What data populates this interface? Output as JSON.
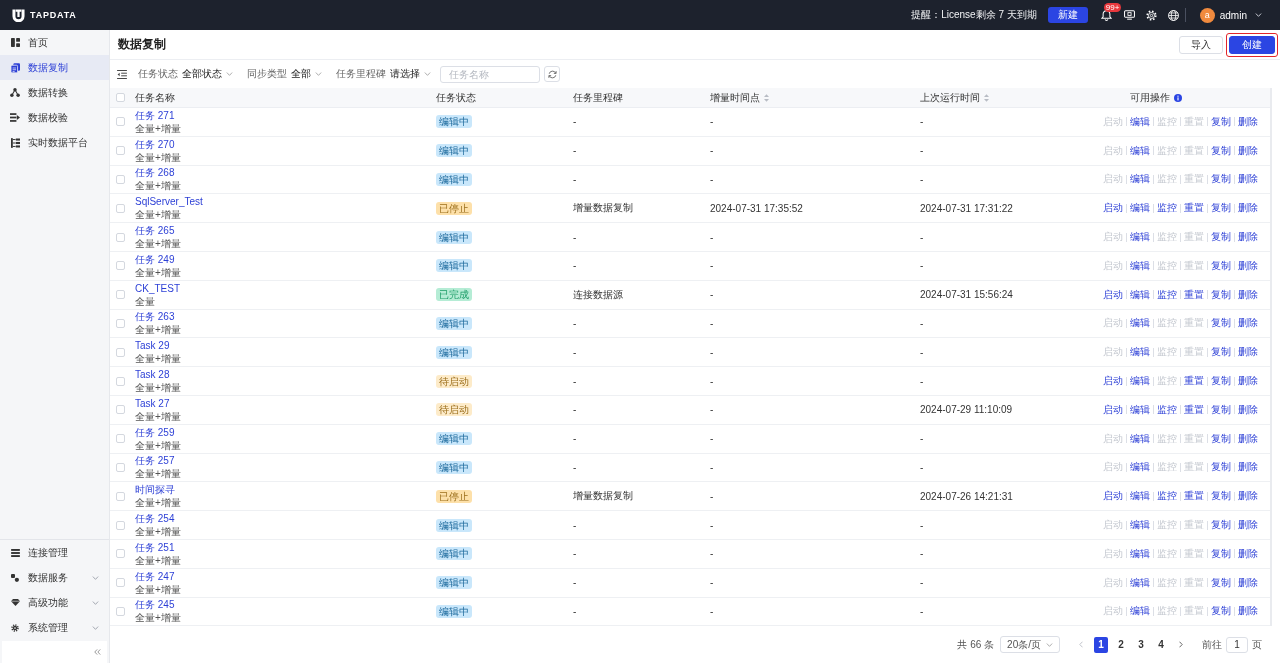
{
  "topbar": {
    "logo": "TAPDATA",
    "notice": "提醒：License剩余 7 天到期",
    "new_button": "新建",
    "badge": "99+",
    "avatar": "a",
    "user": "admin"
  },
  "sidebar": {
    "items": [
      {
        "label": "首页",
        "selected": false
      },
      {
        "label": "数据复制",
        "selected": true
      },
      {
        "label": "数据转换",
        "selected": false
      },
      {
        "label": "数据校验",
        "selected": false
      },
      {
        "label": "实时数据平台",
        "selected": false
      }
    ],
    "bottom_items": [
      {
        "label": "连接管理",
        "expandable": false
      },
      {
        "label": "数据服务",
        "expandable": true
      },
      {
        "label": "高级功能",
        "expandable": true
      },
      {
        "label": "系统管理",
        "expandable": true
      }
    ]
  },
  "page": {
    "title": "数据复制",
    "buttons": [
      {
        "label": "导入",
        "primary": false,
        "highlighted": false
      },
      {
        "label": "创建",
        "primary": true,
        "highlighted": true
      }
    ]
  },
  "filters": {
    "items": [
      {
        "label": "任务状态",
        "value": "全部状态"
      },
      {
        "label": "同步类型",
        "value": "全部"
      },
      {
        "label": "任务里程碑",
        "value": "请选择"
      }
    ],
    "search": {
      "placeholder": "任务名称"
    }
  },
  "table": {
    "all_checked": false,
    "columns": [
      {
        "label": "任务名称",
        "sortable": false,
        "info": false
      },
      {
        "label": "任务状态",
        "sortable": false,
        "info": false
      },
      {
        "label": "任务里程碑",
        "sortable": false,
        "info": false
      },
      {
        "label": "增量时间点",
        "sortable": true,
        "info": false
      },
      {
        "label": "上次运行时间",
        "sortable": true,
        "info": false
      },
      {
        "label": "可用操作",
        "sortable": false,
        "info": true
      }
    ],
    "rows": [
      {
        "checked": false,
        "name": "任务 271",
        "sync_type": "全量+增量",
        "status": {
          "label": "编辑中",
          "color": "#c9e7fb"
        },
        "milestone": "-",
        "incremental_time": "-",
        "last_run": "-",
        "actions": [
          {
            "label": "启动",
            "disabled": true
          },
          {
            "label": "编辑",
            "disabled": false
          },
          {
            "label": "监控",
            "disabled": true
          },
          {
            "label": "重置",
            "disabled": true
          },
          {
            "label": "复制",
            "disabled": false
          },
          {
            "label": "删除",
            "disabled": false
          }
        ]
      },
      {
        "checked": false,
        "name": "任务 270",
        "sync_type": "全量+增量",
        "status": {
          "label": "编辑中",
          "color": "#c9e7fb"
        },
        "milestone": "-",
        "incremental_time": "-",
        "last_run": "-",
        "actions": [
          {
            "label": "启动",
            "disabled": true
          },
          {
            "label": "编辑",
            "disabled": false
          },
          {
            "label": "监控",
            "disabled": true
          },
          {
            "label": "重置",
            "disabled": true
          },
          {
            "label": "复制",
            "disabled": false
          },
          {
            "label": "删除",
            "disabled": false
          }
        ]
      },
      {
        "checked": false,
        "name": "任务 268",
        "sync_type": "全量+增量",
        "status": {
          "label": "编辑中",
          "color": "#c9e7fb"
        },
        "milestone": "-",
        "incremental_time": "-",
        "last_run": "-",
        "actions": [
          {
            "label": "启动",
            "disabled": true
          },
          {
            "label": "编辑",
            "disabled": false
          },
          {
            "label": "监控",
            "disabled": true
          },
          {
            "label": "重置",
            "disabled": true
          },
          {
            "label": "复制",
            "disabled": false
          },
          {
            "label": "删除",
            "disabled": false
          }
        ]
      },
      {
        "checked": false,
        "name": "SqlServer_Test",
        "sync_type": "全量+增量",
        "status": {
          "label": "已停止",
          "color": "#fde0a9"
        },
        "milestone": "增量数据复制",
        "incremental_time": "2024-07-31 17:35:52",
        "last_run": "2024-07-31 17:31:22",
        "actions": [
          {
            "label": "启动",
            "disabled": false
          },
          {
            "label": "编辑",
            "disabled": false
          },
          {
            "label": "监控",
            "disabled": false
          },
          {
            "label": "重置",
            "disabled": false
          },
          {
            "label": "复制",
            "disabled": false
          },
          {
            "label": "删除",
            "disabled": false
          }
        ]
      },
      {
        "checked": false,
        "name": "任务 265",
        "sync_type": "全量+增量",
        "status": {
          "label": "编辑中",
          "color": "#c9e7fb"
        },
        "milestone": "-",
        "incremental_time": "-",
        "last_run": "-",
        "actions": [
          {
            "label": "启动",
            "disabled": true
          },
          {
            "label": "编辑",
            "disabled": false
          },
          {
            "label": "监控",
            "disabled": true
          },
          {
            "label": "重置",
            "disabled": true
          },
          {
            "label": "复制",
            "disabled": false
          },
          {
            "label": "删除",
            "disabled": false
          }
        ]
      },
      {
        "checked": false,
        "name": "任务 249",
        "sync_type": "全量+增量",
        "status": {
          "label": "编辑中",
          "color": "#c9e7fb"
        },
        "milestone": "-",
        "incremental_time": "-",
        "last_run": "-",
        "actions": [
          {
            "label": "启动",
            "disabled": true
          },
          {
            "label": "编辑",
            "disabled": false
          },
          {
            "label": "监控",
            "disabled": true
          },
          {
            "label": "重置",
            "disabled": true
          },
          {
            "label": "复制",
            "disabled": false
          },
          {
            "label": "删除",
            "disabled": false
          }
        ]
      },
      {
        "checked": false,
        "name": "CK_TEST",
        "sync_type": "全量",
        "status": {
          "label": "已完成",
          "color": "#b5ecd5"
        },
        "milestone": "连接数据源",
        "incremental_time": "-",
        "last_run": "2024-07-31 15:56:24",
        "actions": [
          {
            "label": "启动",
            "disabled": false
          },
          {
            "label": "编辑",
            "disabled": false
          },
          {
            "label": "监控",
            "disabled": false
          },
          {
            "label": "重置",
            "disabled": false
          },
          {
            "label": "复制",
            "disabled": false
          },
          {
            "label": "删除",
            "disabled": false
          }
        ]
      },
      {
        "checked": false,
        "name": "任务 263",
        "sync_type": "全量+增量",
        "status": {
          "label": "编辑中",
          "color": "#c9e7fb"
        },
        "milestone": "-",
        "incremental_time": "-",
        "last_run": "-",
        "actions": [
          {
            "label": "启动",
            "disabled": true
          },
          {
            "label": "编辑",
            "disabled": false
          },
          {
            "label": "监控",
            "disabled": true
          },
          {
            "label": "重置",
            "disabled": true
          },
          {
            "label": "复制",
            "disabled": false
          },
          {
            "label": "删除",
            "disabled": false
          }
        ]
      },
      {
        "checked": false,
        "name": "Task 29",
        "sync_type": "全量+增量",
        "status": {
          "label": "编辑中",
          "color": "#c9e7fb"
        },
        "milestone": "-",
        "incremental_time": "-",
        "last_run": "-",
        "actions": [
          {
            "label": "启动",
            "disabled": true
          },
          {
            "label": "编辑",
            "disabled": false
          },
          {
            "label": "监控",
            "disabled": true
          },
          {
            "label": "重置",
            "disabled": true
          },
          {
            "label": "复制",
            "disabled": false
          },
          {
            "label": "删除",
            "disabled": false
          }
        ]
      },
      {
        "checked": false,
        "name": "Task 28",
        "sync_type": "全量+增量",
        "status": {
          "label": "待启动",
          "color": "#fdebc9"
        },
        "milestone": "-",
        "incremental_time": "-",
        "last_run": "-",
        "actions": [
          {
            "label": "启动",
            "disabled": false
          },
          {
            "label": "编辑",
            "disabled": false
          },
          {
            "label": "监控",
            "disabled": true
          },
          {
            "label": "重置",
            "disabled": false
          },
          {
            "label": "复制",
            "disabled": false
          },
          {
            "label": "删除",
            "disabled": false
          }
        ]
      },
      {
        "checked": false,
        "name": "Task 27",
        "sync_type": "全量+增量",
        "status": {
          "label": "待启动",
          "color": "#fdebc9"
        },
        "milestone": "-",
        "incremental_time": "-",
        "last_run": "2024-07-29 11:10:09",
        "actions": [
          {
            "label": "启动",
            "disabled": false
          },
          {
            "label": "编辑",
            "disabled": false
          },
          {
            "label": "监控",
            "disabled": false
          },
          {
            "label": "重置",
            "disabled": false
          },
          {
            "label": "复制",
            "disabled": false
          },
          {
            "label": "删除",
            "disabled": false
          }
        ]
      },
      {
        "checked": false,
        "name": "任务 259",
        "sync_type": "全量+增量",
        "status": {
          "label": "编辑中",
          "color": "#c9e7fb"
        },
        "milestone": "-",
        "incremental_time": "-",
        "last_run": "-",
        "actions": [
          {
            "label": "启动",
            "disabled": true
          },
          {
            "label": "编辑",
            "disabled": false
          },
          {
            "label": "监控",
            "disabled": true
          },
          {
            "label": "重置",
            "disabled": true
          },
          {
            "label": "复制",
            "disabled": false
          },
          {
            "label": "删除",
            "disabled": false
          }
        ]
      },
      {
        "checked": false,
        "name": "任务 257",
        "sync_type": "全量+增量",
        "status": {
          "label": "编辑中",
          "color": "#c9e7fb"
        },
        "milestone": "-",
        "incremental_time": "-",
        "last_run": "-",
        "actions": [
          {
            "label": "启动",
            "disabled": true
          },
          {
            "label": "编辑",
            "disabled": false
          },
          {
            "label": "监控",
            "disabled": true
          },
          {
            "label": "重置",
            "disabled": true
          },
          {
            "label": "复制",
            "disabled": false
          },
          {
            "label": "删除",
            "disabled": false
          }
        ]
      },
      {
        "checked": false,
        "name": "时间探寻",
        "sync_type": "全量+增量",
        "status": {
          "label": "已停止",
          "color": "#fde0a9"
        },
        "milestone": "增量数据复制",
        "incremental_time": "-",
        "last_run": "2024-07-26 14:21:31",
        "actions": [
          {
            "label": "启动",
            "disabled": false
          },
          {
            "label": "编辑",
            "disabled": false
          },
          {
            "label": "监控",
            "disabled": false
          },
          {
            "label": "重置",
            "disabled": false
          },
          {
            "label": "复制",
            "disabled": false
          },
          {
            "label": "删除",
            "disabled": false
          }
        ]
      },
      {
        "checked": false,
        "name": "任务 254",
        "sync_type": "全量+增量",
        "status": {
          "label": "编辑中",
          "color": "#c9e7fb"
        },
        "milestone": "-",
        "incremental_time": "-",
        "last_run": "-",
        "actions": [
          {
            "label": "启动",
            "disabled": true
          },
          {
            "label": "编辑",
            "disabled": false
          },
          {
            "label": "监控",
            "disabled": true
          },
          {
            "label": "重置",
            "disabled": true
          },
          {
            "label": "复制",
            "disabled": false
          },
          {
            "label": "删除",
            "disabled": false
          }
        ]
      },
      {
        "checked": false,
        "name": "任务 251",
        "sync_type": "全量+增量",
        "status": {
          "label": "编辑中",
          "color": "#c9e7fb"
        },
        "milestone": "-",
        "incremental_time": "-",
        "last_run": "-",
        "actions": [
          {
            "label": "启动",
            "disabled": true
          },
          {
            "label": "编辑",
            "disabled": false
          },
          {
            "label": "监控",
            "disabled": true
          },
          {
            "label": "重置",
            "disabled": true
          },
          {
            "label": "复制",
            "disabled": false
          },
          {
            "label": "删除",
            "disabled": false
          }
        ]
      },
      {
        "checked": false,
        "name": "任务 247",
        "sync_type": "全量+增量",
        "status": {
          "label": "编辑中",
          "color": "#c9e7fb"
        },
        "milestone": "-",
        "incremental_time": "-",
        "last_run": "-",
        "actions": [
          {
            "label": "启动",
            "disabled": true
          },
          {
            "label": "编辑",
            "disabled": false
          },
          {
            "label": "监控",
            "disabled": true
          },
          {
            "label": "重置",
            "disabled": true
          },
          {
            "label": "复制",
            "disabled": false
          },
          {
            "label": "删除",
            "disabled": false
          }
        ]
      },
      {
        "checked": false,
        "name": "任务 245",
        "sync_type": "全量+增量",
        "status": {
          "label": "编辑中",
          "color": "#c9e7fb"
        },
        "milestone": "-",
        "incremental_time": "-",
        "last_run": "-",
        "actions": [
          {
            "label": "启动",
            "disabled": true
          },
          {
            "label": "编辑",
            "disabled": false
          },
          {
            "label": "监控",
            "disabled": true
          },
          {
            "label": "重置",
            "disabled": true
          },
          {
            "label": "复制",
            "disabled": false
          },
          {
            "label": "删除",
            "disabled": false
          }
        ]
      }
    ]
  },
  "pagination": {
    "total": "共 66 条",
    "page_size": "20条/页",
    "pages": [
      {
        "label": "1",
        "selected": true
      },
      {
        "label": "2",
        "selected": false
      },
      {
        "label": "3",
        "selected": false
      },
      {
        "label": "4",
        "selected": false
      }
    ],
    "goto_label": "前往",
    "goto_value": "1",
    "goto_suffix": "页"
  }
}
